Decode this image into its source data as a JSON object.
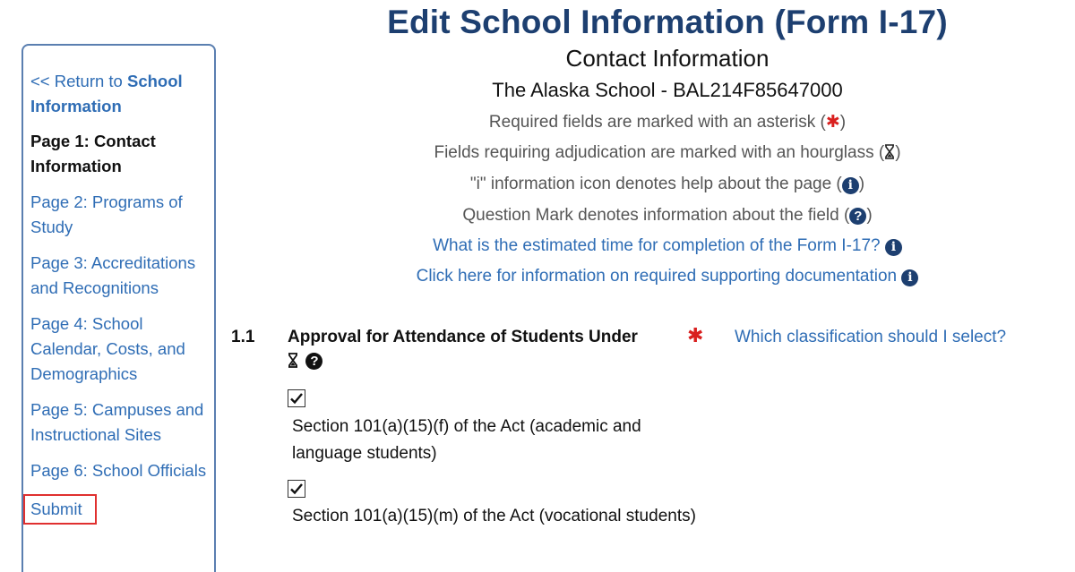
{
  "sidebar": {
    "return_prefix": "<< Return to ",
    "return_target": "School Information",
    "items": [
      {
        "label": "Page 1: Contact Information"
      },
      {
        "label": "Page 2: Programs of Study"
      },
      {
        "label": "Page 3: Accreditations and Recognitions"
      },
      {
        "label": "Page 4: School Calendar, Costs, and Demographics"
      },
      {
        "label": "Page 5: Campuses and Instructional Sites"
      },
      {
        "label": "Page 6: School Officials"
      }
    ],
    "submit_label": "Submit"
  },
  "header": {
    "title": "Edit School Information (Form I-17)",
    "subtitle": "Contact Information",
    "school": "The Alaska School - BAL214F85647000"
  },
  "legend": {
    "required_text": "Required fields are marked with an asterisk (",
    "adjudication_text": "Fields requiring adjudication are marked with an hourglass (",
    "info_text": "\"i\" information icon denotes help about the page (",
    "question_text": "Question Mark denotes information about the field (",
    "close_paren": ")"
  },
  "links": {
    "time_estimate": "What is the estimated time for completion of the Form I-17?",
    "supporting_docs": "Click here for information on required supporting documentation"
  },
  "question": {
    "number": "1.1",
    "label": "Approval for Attendance of Students Under",
    "help_link": "Which classification should I select?",
    "options": [
      {
        "label": "Section 101(a)(15)(f) of the Act (academic and language students)",
        "checked": true
      },
      {
        "label": "Section 101(a)(15)(m) of the Act (vocational students)",
        "checked": true
      }
    ]
  },
  "colors": {
    "title": "#1d3f70",
    "link": "#2f6db5",
    "asterisk": "#d9201f",
    "icon": "#1d3f70",
    "submit_highlight": "#e0302f"
  },
  "icons": {
    "asterisk": "asterisk-icon",
    "hourglass": "hourglass-icon",
    "info": "info-icon",
    "question": "question-icon"
  }
}
